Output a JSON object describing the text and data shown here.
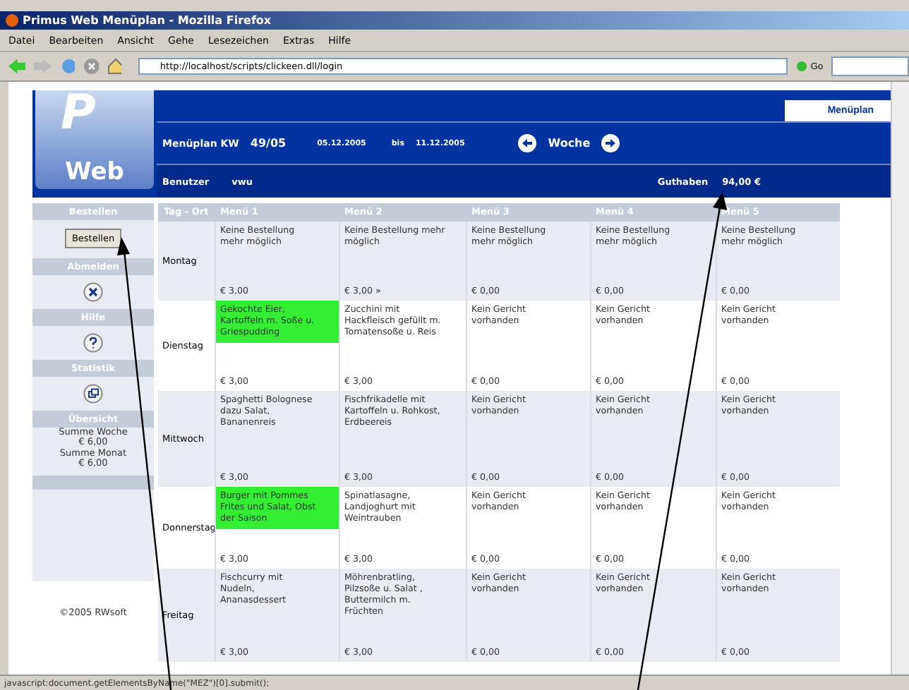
{
  "window": {
    "title": "Primus Web Menüplan - Mozilla Firefox"
  },
  "menu_bar": [
    "Datei",
    "Bearbeiten",
    "Ansicht",
    "Gehe",
    "Lesezeichen",
    "Extras",
    "Hilfe"
  ],
  "address_bar": {
    "value": "http://localhost/scripts/clickeen.dll/login",
    "go": "Go"
  },
  "header": {
    "logo_letter": "P",
    "logo_text": "Web",
    "tab": "Menüplan",
    "plan_label": "Menüplan KW",
    "week": "49/05",
    "date_from": "05.12.2005",
    "bis": "bis",
    "date_to": "11.12.2005",
    "week_label": "Woche",
    "user_label": "Benutzer",
    "user": "vwu",
    "balance_label": "Guthaben",
    "balance": "94,00 €"
  },
  "sidebar": {
    "order_heading": "Bestellen",
    "order_button": "Bestellen",
    "logout_heading": "Abmelden",
    "help_heading": "Hilfe",
    "stats_heading": "Statistik",
    "overview_heading": "Übersicht",
    "overview": [
      "Summe Woche",
      "€ 6,00",
      "Summe Monat",
      "€ 6,00"
    ],
    "copyright": "©2005 RWsoft"
  },
  "table": {
    "columns": [
      "Tag - Ort",
      "Menü 1",
      "Menü 2",
      "Menü 3",
      "Menü 4",
      "Menü 5"
    ],
    "rows": [
      {
        "cells": [
          {
            "kind": "day",
            "text": "Montag"
          },
          {
            "text": "Keine Bestellung mehr möglich",
            "price": "€ 3,00",
            "selected": false
          },
          {
            "text": "Keine Bestellung mehr möglich",
            "price": "€ 3,00 »",
            "selected": false
          },
          {
            "text": "Keine Bestellung mehr möglich",
            "price": "€ 0,00",
            "selected": false
          },
          {
            "text": "Keine Bestellung mehr möglich",
            "price": "€ 0,00",
            "selected": false
          },
          {
            "text": "Keine Bestellung mehr möglich",
            "price": "€ 0,00",
            "selected": false
          }
        ]
      },
      {
        "cells": [
          {
            "kind": "day",
            "text": "Dienstag"
          },
          {
            "text": "Gekochte Eier, Kartoffeln m. Soße u. Griespudding",
            "price": "€ 3,00",
            "selected": true
          },
          {
            "text": "Zucchini mit Hackfleisch gefüllt m. Tomatensoße u. Reis",
            "price": "€ 3,00",
            "selected": false
          },
          {
            "text": "Kein Gericht vorhanden",
            "price": "€ 0,00",
            "selected": false
          },
          {
            "text": "Kein Gericht vorhanden",
            "price": "€ 0,00",
            "selected": false
          },
          {
            "text": "Kein Gericht vorhanden",
            "price": "€ 0,00",
            "selected": false
          }
        ]
      },
      {
        "cells": [
          {
            "kind": "day",
            "text": "Mittwoch"
          },
          {
            "text": "Spaghetti Bolognese dazu Salat, Bananenreis",
            "price": "€ 3,00",
            "selected": false
          },
          {
            "text": "Fischfrikadelle mit Kartoffeln u. Rohkost, Erdbeereis",
            "price": "€ 3,00",
            "selected": false
          },
          {
            "text": "Kein Gericht vorhanden",
            "price": "€ 0,00",
            "selected": false
          },
          {
            "text": "Kein Gericht vorhanden",
            "price": "€ 0,00",
            "selected": false
          },
          {
            "text": "Kein Gericht vorhanden",
            "price": "€ 0,00",
            "selected": false
          }
        ]
      },
      {
        "cells": [
          {
            "kind": "day",
            "text": "Donnerstag"
          },
          {
            "text": "Burger mit Pommes Frites und Salat, Obst der Saison",
            "price": "€ 3,00",
            "selected": true
          },
          {
            "text": "Spinatlasagne, Landjoghurt mit Weintrauben",
            "price": "€ 3,00",
            "selected": false
          },
          {
            "text": "Kein Gericht vorhanden",
            "price": "€ 0,00",
            "selected": false
          },
          {
            "text": "Kein Gericht vorhanden",
            "price": "€ 0,00",
            "selected": false
          },
          {
            "text": "Kein Gericht vorhanden",
            "price": "€ 0,00",
            "selected": false
          }
        ]
      },
      {
        "cells": [
          {
            "kind": "day",
            "text": "Freitag"
          },
          {
            "text": "Fischcurry mit Nudeln, Ananasdessert",
            "price": "€ 3,00",
            "selected": false
          },
          {
            "text": "Möhrenbratling, Pilzsoße u. Salat , Buttermilch m. Früchten",
            "price": "€ 3,00",
            "selected": false
          },
          {
            "text": "Kein Gericht vorhanden",
            "price": "€ 0,00",
            "selected": false
          },
          {
            "text": "Kein Gericht vorhanden",
            "price": "€ 0,00",
            "selected": false
          },
          {
            "text": "Kein Gericht vorhanden",
            "price": "€ 0,00",
            "selected": false
          }
        ]
      }
    ]
  },
  "status_bar": "javascript:document.getElementsByName(\"MEZ\")[0].submit();"
}
